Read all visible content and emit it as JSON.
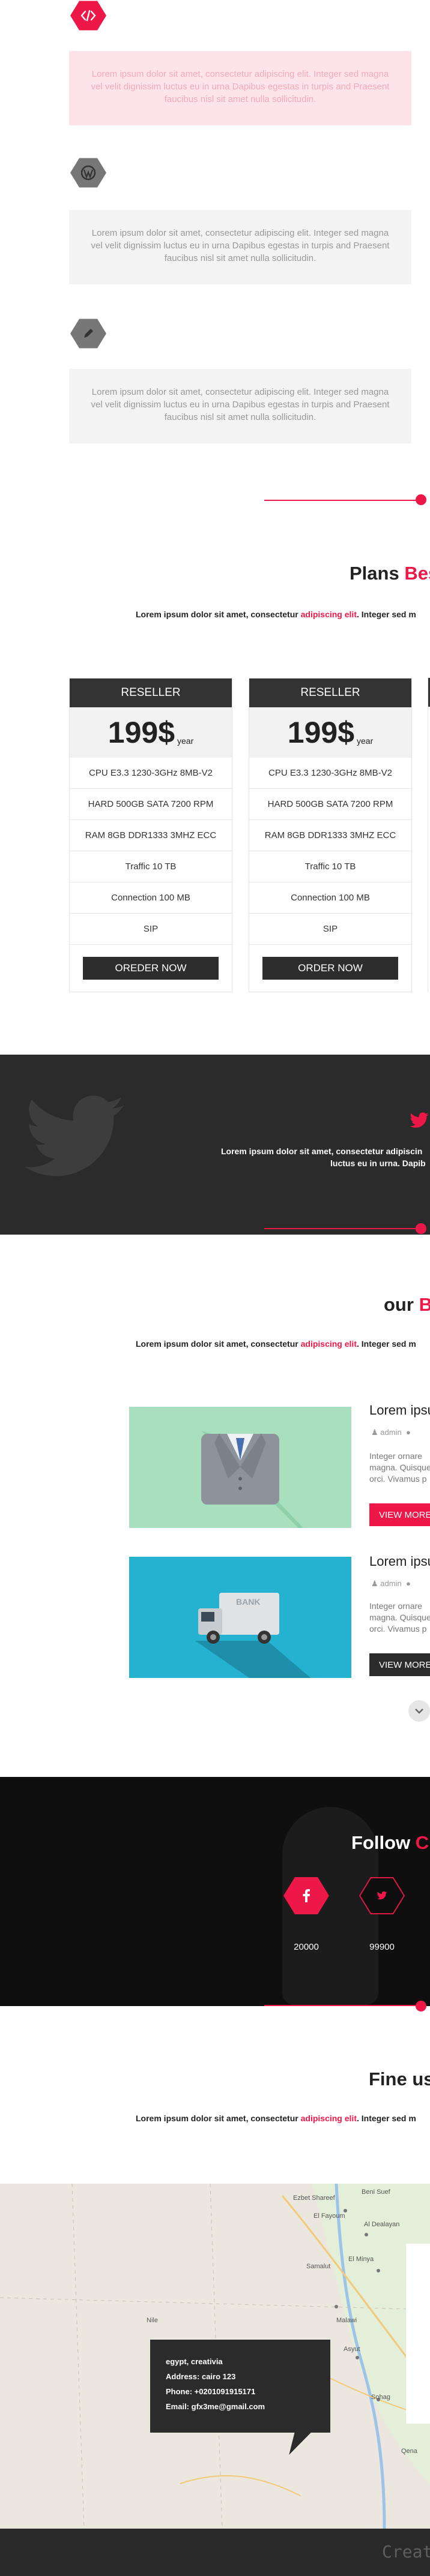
{
  "features": [
    {
      "icon": "code-icon",
      "text": "Lorem ipsum dolor sit amet, consectetur adipiscing elit. Integer sed magna vel velit dignissim luctus eu in urna Dapibus egestas in turpis and Praesent faucibus nisl sit amet nulla sollicitudin."
    },
    {
      "icon": "wordpress-icon",
      "text": "Lorem ipsum dolor sit amet, consectetur adipiscing elit. Integer sed magna vel velit dignissim luctus eu in urna Dapibus egestas in turpis and Praesent faucibus nisl sit amet nulla sollicitudin."
    },
    {
      "icon": "pencil-icon",
      "text": "Lorem ipsum dolor sit amet, consectetur adipiscing elit. Integer sed magna vel velit dignissim luctus eu in urna Dapibus egestas in turpis and Praesent faucibus nisl sit amet nulla sollicitudin."
    }
  ],
  "plans_section": {
    "title": "Plans",
    "title_accent": "Bes",
    "sub_pre": "Lorem ipsum dolor sit amet, consectetur ",
    "sub_accent": "adipiscing elit",
    "sub_post": ". Integer sed m"
  },
  "plans": [
    {
      "name": "RESELLER",
      "price": "199$",
      "period": "year",
      "rows": [
        "CPU E3.3 1230-3GHz 8MB-V2",
        "HARD 500GB SATA 7200 RPM",
        "RAM 8GB DDR1333 3MHZ ECC",
        "Traffic 10 TB",
        "Connection 100 MB",
        "SIP"
      ],
      "button": "OREDER NOW"
    },
    {
      "name": "RESELLER",
      "price": "199$",
      "period": "year",
      "rows": [
        "CPU E3.3 1230-3GHz 8MB-V2",
        "HARD 500GB SATA 7200 RPM",
        "RAM 8GB DDR1333 3MHZ ECC",
        "Traffic 10 TB",
        "Connection 100 MB",
        "SIP"
      ],
      "button": "ORDER NOW"
    }
  ],
  "twitter": {
    "line1": "Lorem ipsum dolor sit amet, consectetur adipiscin",
    "line2": "luctus eu in urna. Dapib"
  },
  "services_section": {
    "title": "our",
    "title_accent": "B",
    "sub_pre": "Lorem ipsum dolor sit amet, consectetur ",
    "sub_accent": "adipiscing elit",
    "sub_post": ". Integer sed m"
  },
  "services": [
    {
      "title": "Lorem ipsu",
      "author": "admin",
      "text": "Integer ornare magna. Quisque orci. Vivamus p",
      "button": "VIEW MORE"
    },
    {
      "title": "Lorem ipsu",
      "author": "admin",
      "text": "Integer ornare magna. Quisque orci. Vivamus p",
      "button": "VIEW MORE"
    }
  ],
  "follow": {
    "title": "Follow",
    "title_accent": "Cr",
    "counts": [
      "20000",
      "99900"
    ]
  },
  "contact_section": {
    "title": "Fine us",
    "sub_pre": "Lorem ipsum dolor sit amet, consectetur ",
    "sub_accent": "adipiscing elit",
    "sub_post": ". Integer sed m"
  },
  "map": {
    "labels": [
      "Beni Suef",
      "Ezbet Shareef",
      "El Fayoum",
      "Al Dealayan",
      "El Minya",
      "Samalut",
      "Asyut",
      "Sohag",
      "Malawi",
      "Qena",
      "Nile"
    ],
    "info": [
      "egypt, creativia",
      "Address: cairo 123",
      "Phone: +0201091915171",
      "Email: gfx3me@gmail.com"
    ]
  },
  "footer": {
    "text": "Creat"
  },
  "colors": {
    "accent": "#ee1848",
    "dark": "#2b2b2b"
  }
}
